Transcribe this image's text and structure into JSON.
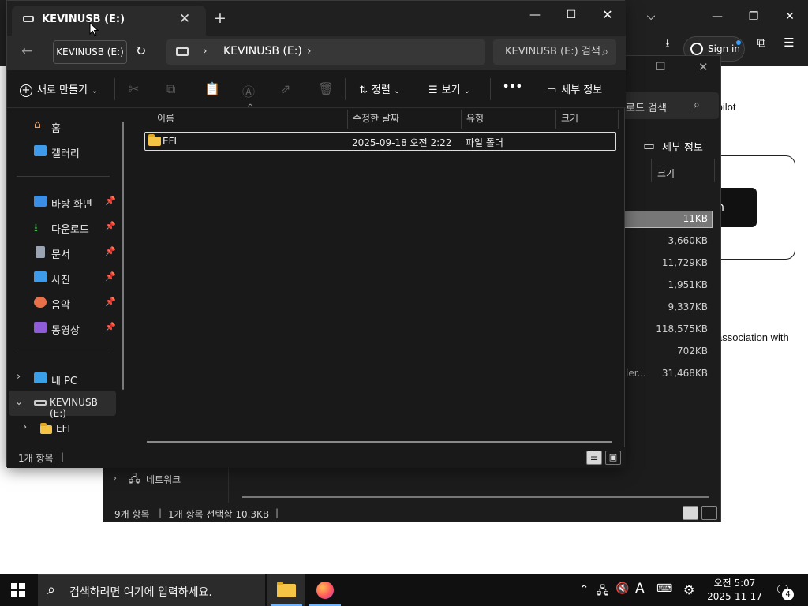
{
  "browser": {
    "signin_label": "Sign in",
    "page_texts": [
      "tpilot",
      "association with"
    ],
    "button_partial": "n"
  },
  "back_explorer": {
    "search_placeholder": "로드 검색",
    "details_label": "세부 정보",
    "col_size": "크기",
    "sizes": [
      "11KB",
      "3,660KB",
      "11,729KB",
      "1,951KB",
      "9,337KB",
      "118,575KB",
      "702KB",
      "31,468KB"
    ],
    "truncated_name": "ler...",
    "nav_network": "네트워크",
    "status_count": "9개 항목",
    "status_selected": "1개 항목 선택함 10.3KB"
  },
  "explorer": {
    "tab_title": "KEVINUSB (E:)",
    "tooltip": "KEVINUSB (E:)",
    "address": [
      "KEVINUSB (E:)"
    ],
    "search_placeholder": "KEVINUSB (E:) 검색",
    "toolbar": {
      "new_label": "새로 만들기",
      "sort_label": "정렬",
      "view_label": "보기",
      "more_label": "•••",
      "details_label": "세부 정보"
    },
    "sidebar": {
      "quick": [
        {
          "label": "홈",
          "icon": "home-icon",
          "pinned": false
        },
        {
          "label": "갤러리",
          "icon": "gallery-icon",
          "pinned": false
        }
      ],
      "pinned": [
        {
          "label": "바탕 화면",
          "icon": "desktop-icon",
          "color": "#3a8ee6"
        },
        {
          "label": "다운로드",
          "icon": "download-icon",
          "color": "#3fb950"
        },
        {
          "label": "문서",
          "icon": "document-icon",
          "color": "#9aa4b2"
        },
        {
          "label": "사진",
          "icon": "pictures-icon",
          "color": "#3d9be9"
        },
        {
          "label": "음악",
          "icon": "music-icon",
          "color": "#e8704a"
        },
        {
          "label": "동영상",
          "icon": "video-icon",
          "color": "#8e5cd9"
        }
      ],
      "tree": [
        {
          "label": "내 PC",
          "icon": "pc-icon"
        },
        {
          "label": "KEVINUSB (E:)",
          "icon": "drive-icon"
        },
        {
          "label": "EFI",
          "icon": "folder-icon"
        }
      ]
    },
    "columns": {
      "name": "이름",
      "date": "수정한 날짜",
      "type": "유형",
      "size": "크기"
    },
    "files": [
      {
        "name": "EFI",
        "date": "2025-09-18 오전 2:22",
        "type": "파일 폴더",
        "size": ""
      }
    ],
    "status": "1개 항목"
  },
  "taskbar": {
    "search_placeholder": "검색하려면 여기에 입력하세요.",
    "ime_label": "A",
    "time": "오전 5:07",
    "date": "2025-11-17",
    "notifications": "4"
  },
  "colors": {
    "accent": "#6fb3ff",
    "folder": "#f5c445"
  }
}
